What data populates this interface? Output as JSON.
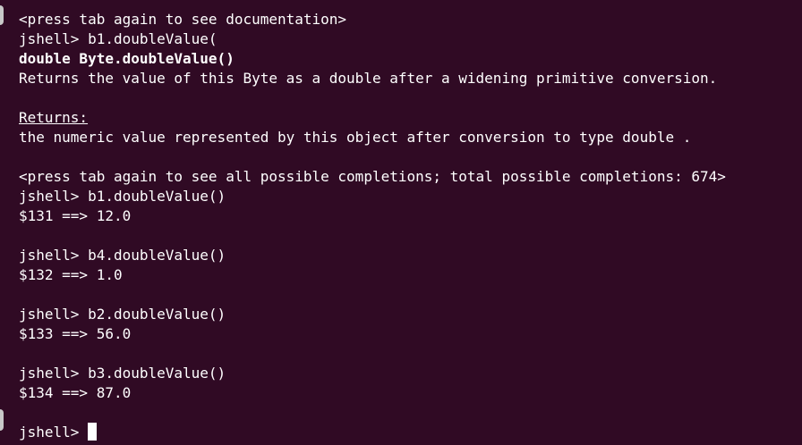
{
  "terminal": {
    "lines": [
      {
        "text": "<press tab again to see documentation>",
        "style": "normal"
      },
      {
        "text": "jshell> b1.doubleValue(",
        "style": "normal"
      },
      {
        "text": "double Byte.doubleValue()",
        "style": "bold"
      },
      {
        "text": "Returns the value of this Byte as a double after a widening primitive conversion.",
        "style": "normal"
      },
      {
        "text": "",
        "style": "normal"
      },
      {
        "text": "Returns:",
        "style": "underline"
      },
      {
        "text": "the numeric value represented by this object after conversion to type double .",
        "style": "normal"
      },
      {
        "text": "",
        "style": "normal"
      },
      {
        "text": "<press tab again to see all possible completions; total possible completions: 674>",
        "style": "normal"
      },
      {
        "text": "jshell> b1.doubleValue()",
        "style": "normal"
      },
      {
        "text": "$131 ==> 12.0",
        "style": "normal"
      },
      {
        "text": "",
        "style": "normal"
      },
      {
        "text": "jshell> b4.doubleValue()",
        "style": "normal"
      },
      {
        "text": "$132 ==> 1.0",
        "style": "normal"
      },
      {
        "text": "",
        "style": "normal"
      },
      {
        "text": "jshell> b2.doubleValue()",
        "style": "normal"
      },
      {
        "text": "$133 ==> 56.0",
        "style": "normal"
      },
      {
        "text": "",
        "style": "normal"
      },
      {
        "text": "jshell> b3.doubleValue()",
        "style": "normal"
      },
      {
        "text": "$134 ==> 87.0",
        "style": "normal"
      },
      {
        "text": "",
        "style": "normal"
      }
    ],
    "prompt": "jshell> ",
    "colors": {
      "background": "#300a24",
      "foreground": "#ffffff"
    }
  }
}
